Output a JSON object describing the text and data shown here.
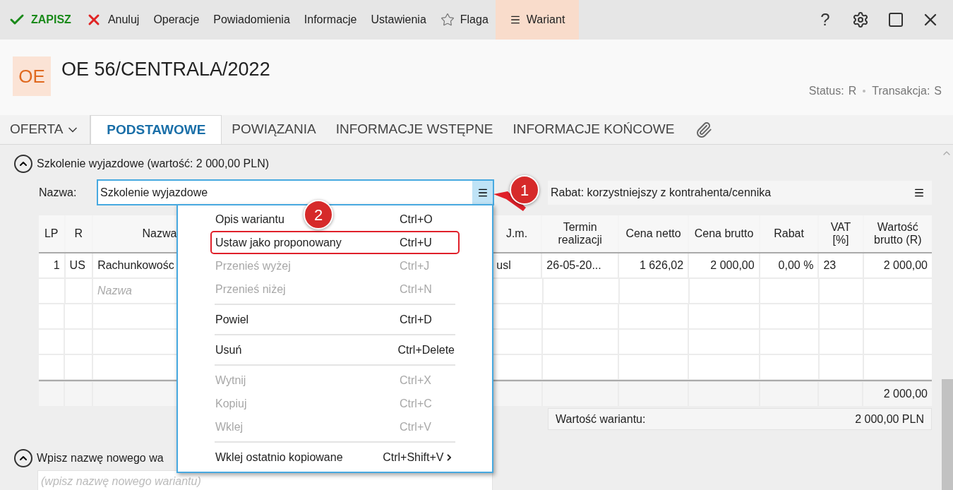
{
  "toolbar": {
    "items": [
      {
        "kind": "save",
        "label": "ZAPISZ",
        "selected": false
      },
      {
        "kind": "cancel",
        "label": "Anuluj",
        "selected": false
      },
      {
        "kind": "plain",
        "label": "Operacje",
        "selected": false
      },
      {
        "kind": "plain",
        "label": "Powiadomienia",
        "selected": false
      },
      {
        "kind": "plain",
        "label": "Informacje",
        "selected": false
      },
      {
        "kind": "plain",
        "label": "Ustawienia",
        "selected": false
      },
      {
        "kind": "flag",
        "label": "Flaga",
        "selected": false
      },
      {
        "kind": "variant",
        "label": "Wariant",
        "selected": true
      }
    ],
    "help_label": "?"
  },
  "header": {
    "badge": "OE",
    "title": "OE 56/CENTRALA/2022",
    "status_label": "Status:",
    "status_value": "R",
    "transaction_label": "Transakcja:",
    "transaction_value": "S"
  },
  "tabs": [
    {
      "label": "OFERTA",
      "dropdown": true,
      "selected": false
    },
    {
      "label": "PODSTAWOWE",
      "dropdown": false,
      "selected": true
    },
    {
      "label": "POWIĄZANIA",
      "dropdown": false,
      "selected": false
    },
    {
      "label": "INFORMACJE WSTĘPNE",
      "dropdown": false,
      "selected": false
    },
    {
      "label": "INFORMACJE KOŃCOWE",
      "dropdown": false,
      "selected": false
    }
  ],
  "variant": {
    "expanded": true,
    "heading": "Szkolenie wyjazdowe (wartość: 2 000,00 PLN)",
    "name_label": "Nazwa:",
    "name_value": "Szkolenie wyjazdowe",
    "discount": "Rabat: korzystniejszy z kontrahenta/cennika",
    "table": {
      "columns": [
        "LP",
        "R",
        "Nazwa",
        "J.m.",
        "Termin realizacji",
        "Cena netto",
        "Cena brutto",
        "Rabat",
        "VAT [%]",
        "Wartość brutto (R)"
      ],
      "rows": [
        {
          "cells": [
            "1",
            "US",
            "Rachunkowośc",
            "usl",
            "26-05-20...",
            "1 626,02",
            "2 000,00",
            "0,00 %",
            "23",
            "2 000,00"
          ]
        }
      ],
      "new_row_placeholder": "Nazwa",
      "total": "2 000,00"
    },
    "value_label": "Wartość wariantu:",
    "value": "2 000,00 PLN"
  },
  "new_variant": {
    "expanded": true,
    "heading": "Wpisz nazwę nowego wa",
    "placeholder": "(wpisz nazwę nowego wariantu)"
  },
  "menu": {
    "items": [
      {
        "kind": "item",
        "label": "Opis wariantu",
        "shortcut": "Ctrl+O",
        "disabled": false,
        "outlined": false,
        "submenu": false
      },
      {
        "kind": "item",
        "label": "Ustaw jako proponowany",
        "shortcut": "Ctrl+U",
        "disabled": false,
        "outlined": true,
        "submenu": false
      },
      {
        "kind": "item",
        "label": "Przenieś wyżej",
        "shortcut": "Ctrl+J",
        "disabled": true,
        "outlined": false,
        "submenu": false
      },
      {
        "kind": "item",
        "label": "Przenieś niżej",
        "shortcut": "Ctrl+N",
        "disabled": true,
        "outlined": false,
        "submenu": false
      },
      {
        "kind": "separator"
      },
      {
        "kind": "item",
        "label": "Powiel",
        "shortcut": "Ctrl+D",
        "disabled": false,
        "outlined": false,
        "submenu": false
      },
      {
        "kind": "separator"
      },
      {
        "kind": "item",
        "label": "Usuń",
        "shortcut": "Ctrl+Delete",
        "disabled": false,
        "outlined": false,
        "submenu": false
      },
      {
        "kind": "separator"
      },
      {
        "kind": "item",
        "label": "Wytnij",
        "shortcut": "Ctrl+X",
        "disabled": true,
        "outlined": false,
        "submenu": false
      },
      {
        "kind": "item",
        "label": "Kopiuj",
        "shortcut": "Ctrl+C",
        "disabled": true,
        "outlined": false,
        "submenu": false
      },
      {
        "kind": "item",
        "label": "Wklej",
        "shortcut": "Ctrl+V",
        "disabled": true,
        "outlined": false,
        "submenu": false
      },
      {
        "kind": "separator"
      },
      {
        "kind": "item",
        "label": "Wklej ostatnio kopiowane",
        "shortcut": "Ctrl+Shift+V",
        "disabled": false,
        "outlined": false,
        "submenu": true
      }
    ]
  },
  "callouts": [
    {
      "label": "1"
    },
    {
      "label": "2"
    }
  ]
}
